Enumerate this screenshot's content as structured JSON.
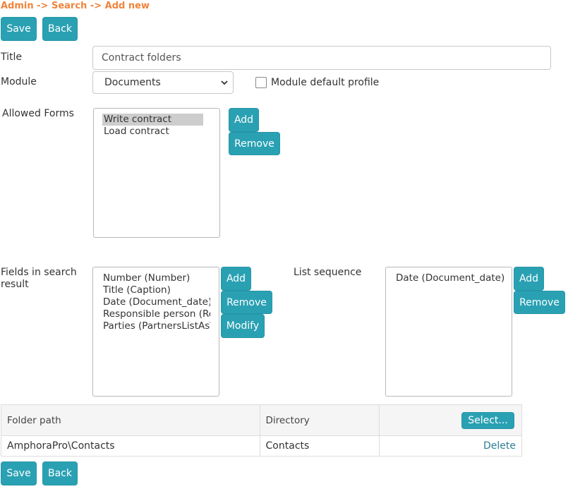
{
  "breadcrumb": "Admin -> Search -> Add new",
  "toolbar": {
    "save_label": "Save",
    "back_label": "Back"
  },
  "title_field": {
    "label": "Title",
    "value": "Contract folders"
  },
  "module_field": {
    "label": "Module",
    "selected": "Documents",
    "default_profile_label": "Module default profile",
    "default_profile_checked": false
  },
  "allowed_forms": {
    "label": "Allowed Forms",
    "items": [
      "Write contract",
      "Load contract"
    ],
    "selected_index": 0,
    "add_label": "Add",
    "remove_label": "Remove"
  },
  "fields_in_search": {
    "label": "Fields in search result",
    "items": [
      "Number (Number)",
      "Title (Caption)",
      "Date (Document_date)",
      "Responsible person (Res",
      "Parties (PartnersListAsTe"
    ],
    "add_label": "Add",
    "remove_label": "Remove",
    "modify_label": "Modify"
  },
  "list_sequence": {
    "label": "List sequence",
    "items": [
      "Date (Document_date) d"
    ],
    "add_label": "Add",
    "remove_label": "Remove"
  },
  "folders_table": {
    "headers": [
      "Folder path",
      "Directory"
    ],
    "select_label": "Select...",
    "rows": [
      {
        "path": "AmphoraPro\\Contacts",
        "directory": "Contacts",
        "action": "Delete"
      }
    ]
  },
  "colors": {
    "accent": "#2aa1b3",
    "breadcrumb": "#f0843c",
    "link": "#2a7f96"
  },
  "icons": {
    "select_arrow": "chevron-down-icon"
  }
}
